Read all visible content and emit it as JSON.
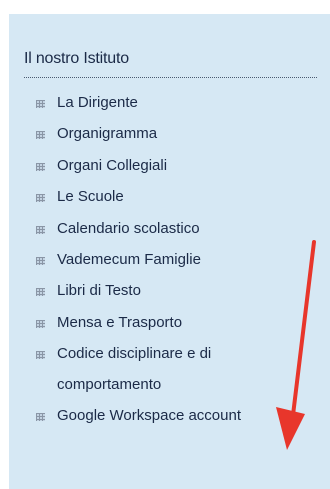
{
  "sidebar": {
    "heading": "Il nostro Istituto",
    "items": [
      {
        "label": "La Dirigente",
        "icon": "grid-bullet-icon"
      },
      {
        "label": "Organigramma",
        "icon": "grid-bullet-icon"
      },
      {
        "label": "Organi Collegiali",
        "icon": "grid-bullet-icon"
      },
      {
        "label": "Le Scuole",
        "icon": "grid-bullet-icon"
      },
      {
        "label": "Calendario scolastico",
        "icon": "grid-bullet-icon"
      },
      {
        "label": "Vademecum Famiglie",
        "icon": "grid-bullet-icon"
      },
      {
        "label": "Libri di Testo",
        "icon": "grid-bullet-icon"
      },
      {
        "label": "Mensa e Trasporto",
        "icon": "grid-bullet-icon"
      },
      {
        "label": "Codice disciplinare e di",
        "label_line2": "comportamento",
        "icon": "grid-bullet-icon"
      },
      {
        "label": "Google Workspace account",
        "icon": "grid-bullet-icon"
      }
    ]
  },
  "colors": {
    "panel_bg": "#d6e8f4",
    "text": "#1b2a47",
    "arrow": "#e8362b"
  },
  "annotation": {
    "icon": "red-arrow-icon"
  }
}
